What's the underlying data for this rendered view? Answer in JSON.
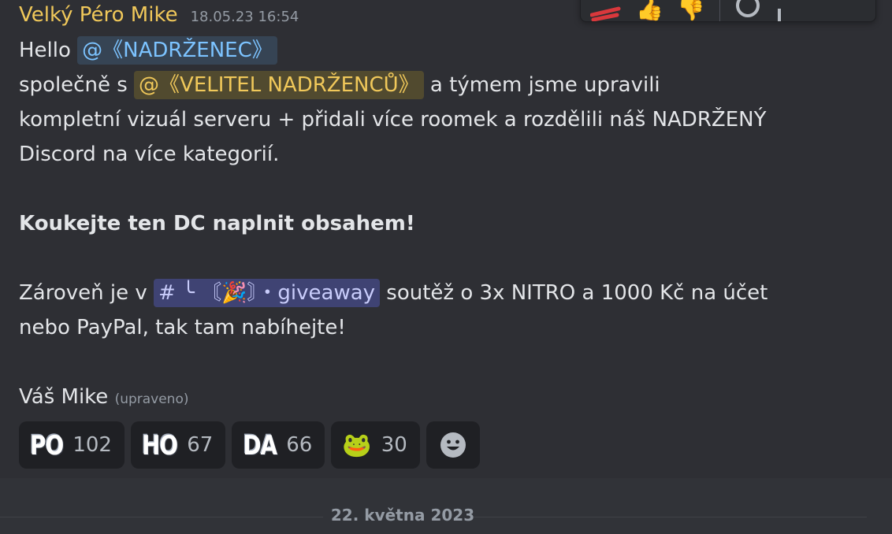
{
  "message": {
    "author": "Velký Péro Mike",
    "timestamp": "18.05.23 16:54",
    "line1_prefix": "Hello",
    "mention1": "@《NADRŽENEC》",
    "line2_prefix": "společně s",
    "mention2": "@《VELITEL NADRŽENCŮ》",
    "line2_suffix": "a týmem jsme upravili",
    "line3": "kompletní vizuál serveru + přidali více roomek a rozdělili náš NADRŽENÝ",
    "line4": "Discord na více kategorií.",
    "bold_line": "Koukejte ten DC naplnit obsahem!",
    "line6_prefix": "Zároveň je v",
    "channel_hash": "#",
    "channel_name": "╰ 〘🎉〙・giveaway",
    "line6_suffix": "soutěž o 3x NITRO a 1000 Kč na účet",
    "line7": "nebo PayPal, tak tam nabíhejte!",
    "signature": "Váš Mike",
    "edited": "(upraveno)"
  },
  "reactions": [
    {
      "emoji": "PO",
      "count": "102"
    },
    {
      "emoji": "HO",
      "count": "67"
    },
    {
      "emoji": "DA",
      "count": "66"
    },
    {
      "emoji": "🐸",
      "count": "30"
    }
  ],
  "add_reaction_icon": "smiley-icon",
  "toolbar_icons": [
    "fire-streak-icon",
    "thumbs-up-icon",
    "thumbs-down-icon",
    "add-reaction-icon"
  ],
  "date_divider": "22. května 2023"
}
